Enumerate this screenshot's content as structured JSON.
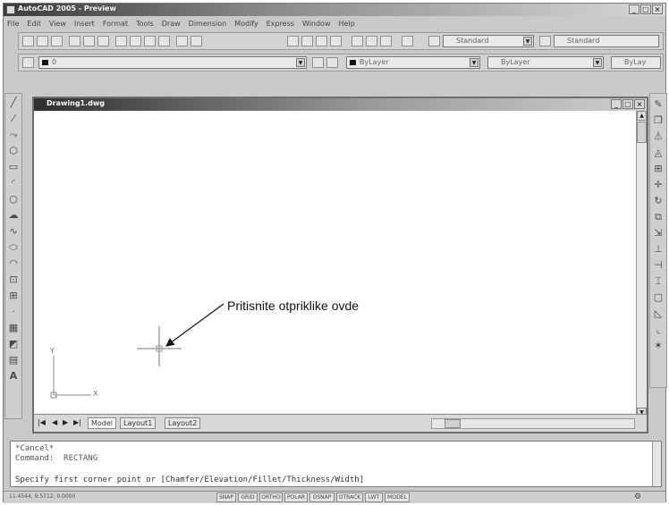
{
  "window": {
    "title": "AutoCAD 2005 - Preview",
    "min": "_",
    "max": "□",
    "close": "×"
  },
  "menu": [
    "File",
    "Edit",
    "View",
    "Insert",
    "Format",
    "Tools",
    "Draw",
    "Dimension",
    "Modify",
    "Express",
    "Window",
    "Help"
  ],
  "toolbars": {
    "textstyle_value": "Standard",
    "dimstyle_value": "Standard",
    "layer_value": "0",
    "color_value": "ByLayer",
    "linetype_value": "ByLayer",
    "lineweight_value": "ByLay"
  },
  "drawing": {
    "title": "Drawing1.dwg",
    "annotation": "Pritisnite otpriklike ovde",
    "tabs": [
      "Model",
      "Layout1",
      "Layout2"
    ],
    "ucs_x": "X",
    "ucs_y": "Y"
  },
  "command": {
    "line1": "*Cancel*",
    "line2": "Command:  RECTANG",
    "line3": "Specify first corner point or [Chamfer/Elevation/Fillet/Thickness/Width]"
  },
  "status": {
    "coords": "11.4544, 9.5712, 0.0000",
    "toggles": [
      "SNAP",
      "GRID",
      "ORTHO",
      "POLAR",
      "OSNAP",
      "OTRACK",
      "LWT",
      "MODEL"
    ]
  }
}
